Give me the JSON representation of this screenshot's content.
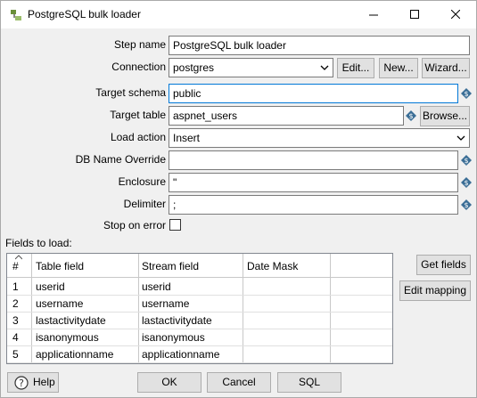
{
  "window": {
    "title": "PostgreSQL bulk loader"
  },
  "form": {
    "step_name": {
      "label": "Step name",
      "value": "PostgreSQL bulk loader"
    },
    "connection": {
      "label": "Connection",
      "value": "postgres",
      "edit_label": "Edit...",
      "new_label": "New...",
      "wizard_label": "Wizard..."
    },
    "target_schema": {
      "label": "Target schema",
      "value": "public"
    },
    "target_table": {
      "label": "Target table",
      "value": "aspnet_users",
      "browse_label": "Browse..."
    },
    "load_action": {
      "label": "Load action",
      "value": "Insert"
    },
    "db_name_override": {
      "label": "DB Name Override",
      "value": ""
    },
    "enclosure": {
      "label": "Enclosure",
      "value": "\""
    },
    "delimiter": {
      "label": "Delimiter",
      "value": ";"
    },
    "stop_on_error": {
      "label": "Stop on error",
      "checked": false
    }
  },
  "fields": {
    "section_label": "Fields to load:",
    "columns": [
      "#",
      "Table field",
      "Stream field",
      "Date Mask"
    ],
    "rows": [
      {
        "n": "1",
        "table_field": "userid",
        "stream_field": "userid",
        "date_mask": ""
      },
      {
        "n": "2",
        "table_field": "username",
        "stream_field": "username",
        "date_mask": ""
      },
      {
        "n": "3",
        "table_field": "lastactivitydate",
        "stream_field": "lastactivitydate",
        "date_mask": ""
      },
      {
        "n": "4",
        "table_field": "isanonymous",
        "stream_field": "isanonymous",
        "date_mask": ""
      },
      {
        "n": "5",
        "table_field": "applicationname",
        "stream_field": "applicationname",
        "date_mask": ""
      }
    ],
    "get_fields_label": "Get fields",
    "edit_mapping_label": "Edit mapping"
  },
  "footer": {
    "help_label": "Help",
    "ok_label": "OK",
    "cancel_label": "Cancel",
    "sql_label": "SQL"
  },
  "colors": {
    "focus_border": "#0078d7",
    "variable_icon": "#3b6e96"
  },
  "icons": [
    "app-icon",
    "minimize-icon",
    "maximize-icon",
    "close-icon",
    "chevron-down-icon",
    "variable-dollar-icon",
    "help-icon"
  ]
}
